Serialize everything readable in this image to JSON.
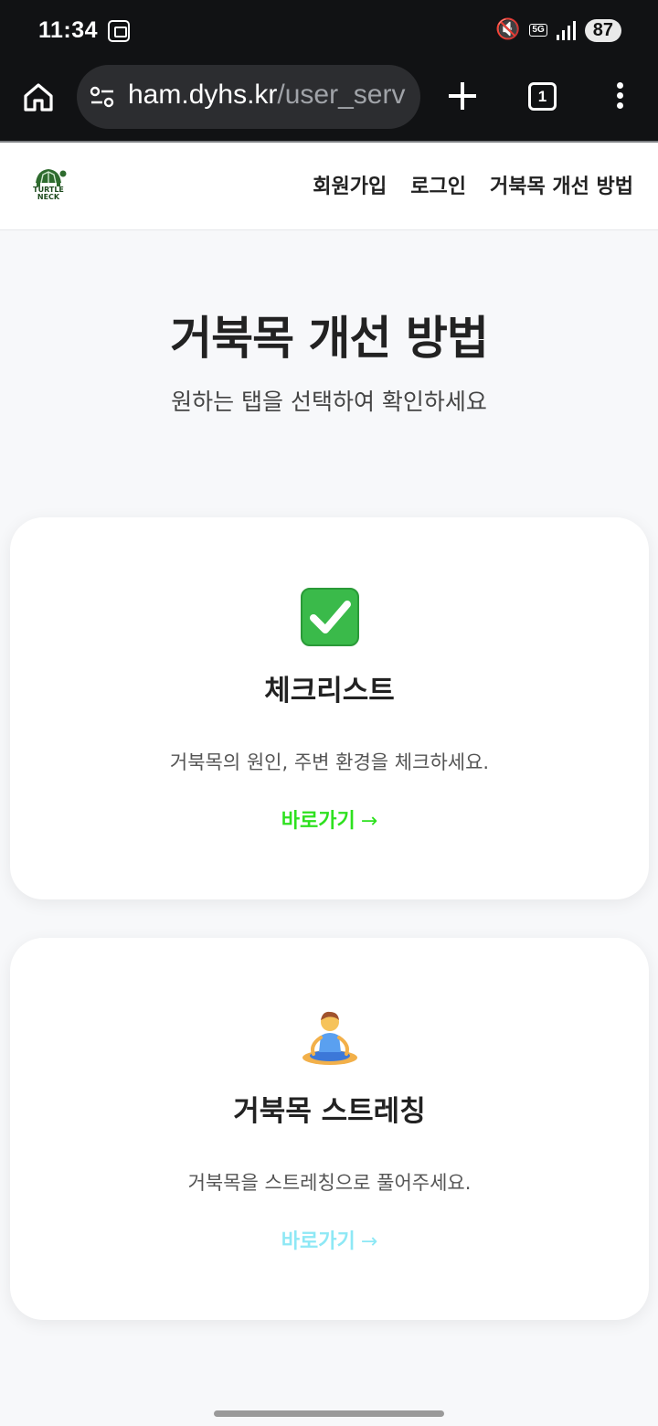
{
  "status_bar": {
    "time": "11:34",
    "network": "5G",
    "battery": "87",
    "icons": [
      "screenshot-icon",
      "mute-icon",
      "signal-icon"
    ]
  },
  "browser": {
    "url_host": "ham.dyhs.kr",
    "url_path": "/user_serv",
    "tab_count": "1",
    "icons": [
      "home-icon",
      "site-settings-icon",
      "new-tab-icon",
      "more-menu-icon"
    ]
  },
  "site": {
    "logo_line1": "TURTLE",
    "logo_line2": "NECK",
    "nav": {
      "signup": "회원가입",
      "login": "로그인",
      "improve": "거북목 개선 방법"
    }
  },
  "hero": {
    "title": "거북목 개선 방법",
    "subtitle": "원하는 탭을 선택하여 확인하세요"
  },
  "cards": [
    {
      "icon": "✅",
      "title": "체크리스트",
      "description": "거북목의 원인, 주변 환경을 체크하세요.",
      "link_label": "바로가기",
      "link_arrow": "→",
      "link_color": "#2ee11f"
    },
    {
      "icon": "🧘",
      "title": "거북목 스트레칭",
      "description": "거북목을 스트레칭으로 풀어주세요.",
      "link_label": "바로가기",
      "link_arrow": "→",
      "link_color": "#8ee8f5"
    }
  ],
  "colors": {
    "status_bg": "#111214",
    "page_bg": "#f7f8fa",
    "check_green": "#2ee11f",
    "stretch_cyan": "#8ee8f5"
  }
}
